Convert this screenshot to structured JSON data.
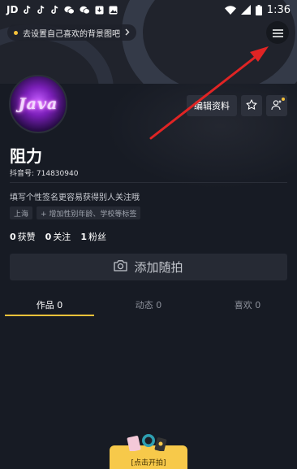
{
  "status_bar": {
    "carrier": "JD",
    "time": "1:36",
    "left_icons": [
      "tiktok-icon",
      "tiktok-icon",
      "tiktok-icon",
      "wechat-icon",
      "wechat-icon",
      "download-icon",
      "image-icon"
    ],
    "right_icons": [
      "wifi-icon",
      "signal-icon",
      "battery-icon"
    ]
  },
  "banner": {
    "hint_text": "去设置自己喜欢的背景图吧",
    "hint_dot_color": "#f6c23a"
  },
  "profile": {
    "avatar_text": "Java",
    "name": "阻力",
    "douyin_id": "抖音号: 714830940",
    "signature": "填写个性签名更容易获得别人关注哦",
    "tags": [
      "上海",
      "+ 增加性别年龄、学校等标签"
    ],
    "edit_button": "编辑资料",
    "stats": [
      {
        "num": "0",
        "label": "获赞"
      },
      {
        "num": "0",
        "label": "关注"
      },
      {
        "num": "1",
        "label": "粉丝"
      }
    ],
    "add_photo": "添加随拍"
  },
  "tabs": [
    {
      "label": "作品 0",
      "active": true
    },
    {
      "label": "动态 0",
      "active": false
    },
    {
      "label": "喜欢 0",
      "active": false
    }
  ],
  "shoot_button": {
    "label": "[点击开拍]"
  },
  "colors": {
    "accent": "#f6c23a",
    "background": "#171b24",
    "annotation_arrow": "#e02424"
  }
}
